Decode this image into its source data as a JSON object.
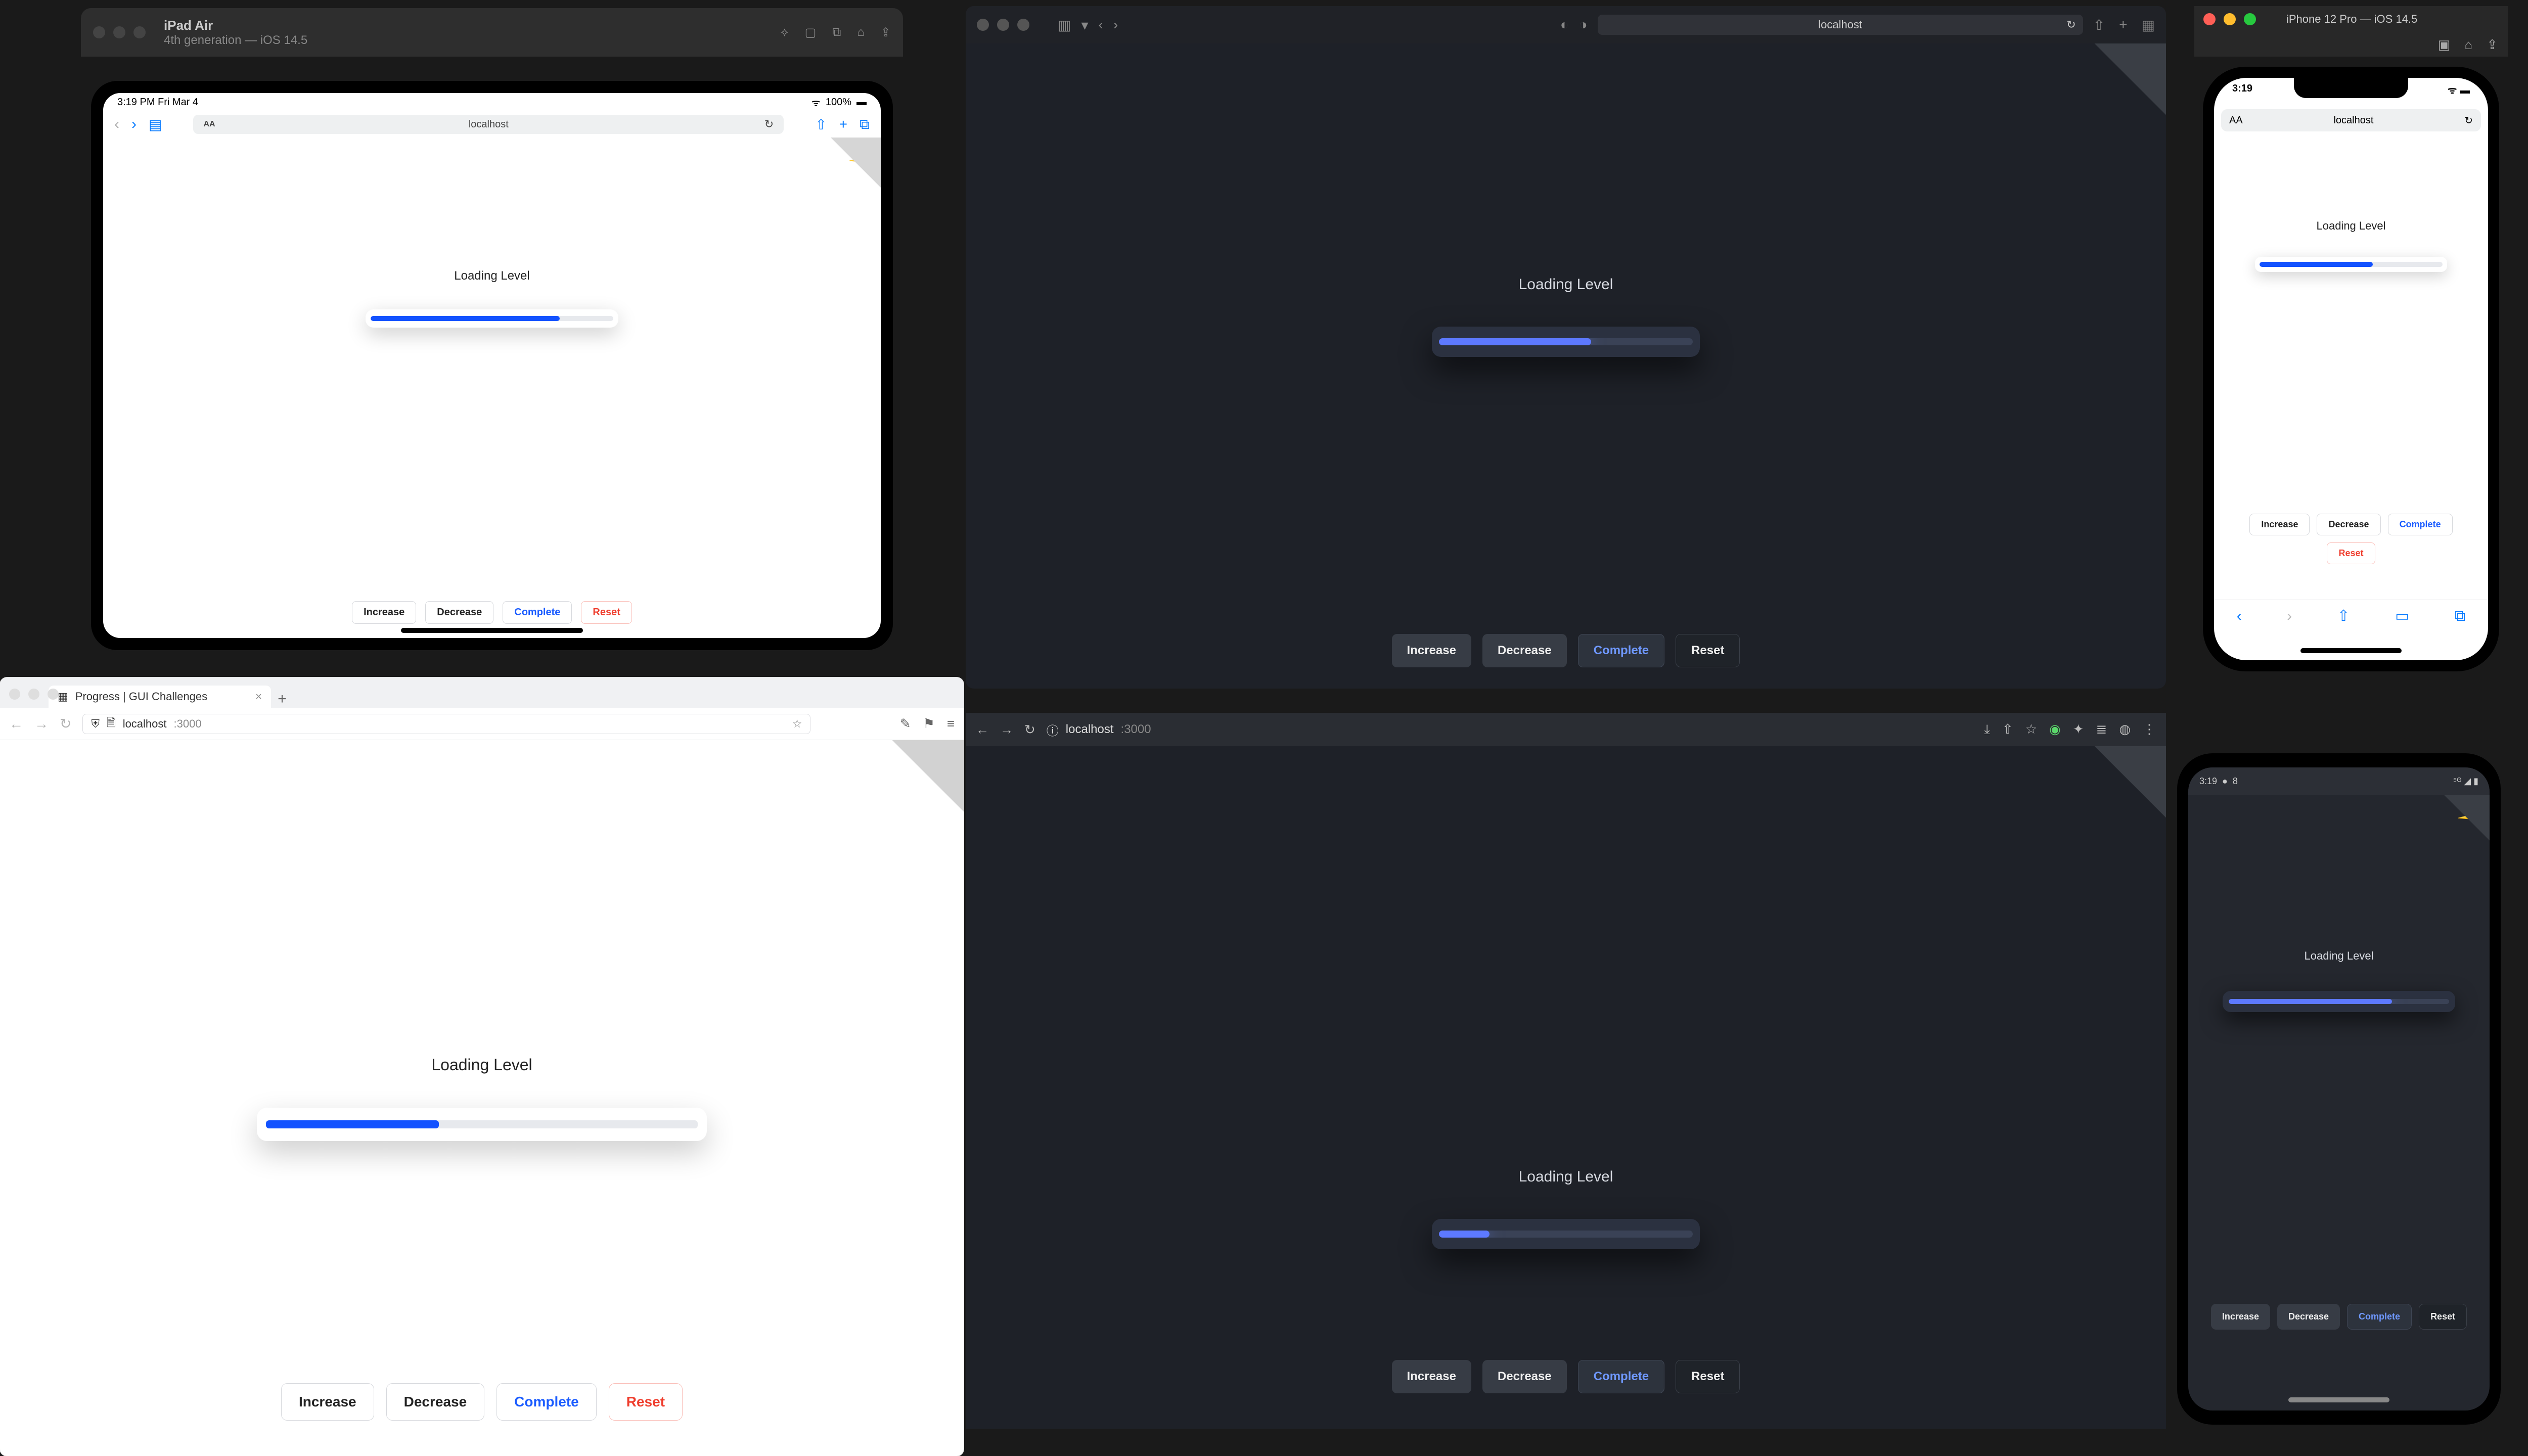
{
  "app": {
    "loading_label": "Loading Level",
    "buttons": {
      "increase": "Increase",
      "decrease": "Decrease",
      "complete": "Complete",
      "reset": "Reset"
    }
  },
  "progress": {
    "ipad_pct": 78,
    "safari_pct": 60,
    "iphone_pct": 62,
    "firefox_pct": 40,
    "chrome_pct": 20,
    "android_pct": 74
  },
  "ipad_sim": {
    "device": "iPad Air",
    "sub": "4th generation — iOS 14.5",
    "status_time": "3:19 PM   Fri Mar 4",
    "battery": "100%",
    "host": "localhost"
  },
  "safari_mac": {
    "host": "localhost"
  },
  "iphone_sim": {
    "title": "iPhone 12 Pro — iOS 14.5",
    "status_time": "3:19",
    "host": "localhost"
  },
  "firefox": {
    "tab_title": "Progress | GUI Challenges",
    "host": "localhost",
    "port": ":3000"
  },
  "chrome_dark": {
    "host": "localhost",
    "port": ":3000"
  },
  "android": {
    "status_time": "3:19",
    "status_icon_text": "8"
  },
  "colors": {
    "accent_light": "#1352ff",
    "accent_dark": "#5d79ff",
    "complete": "#1b5cff",
    "reset": "#ef3e2e"
  }
}
